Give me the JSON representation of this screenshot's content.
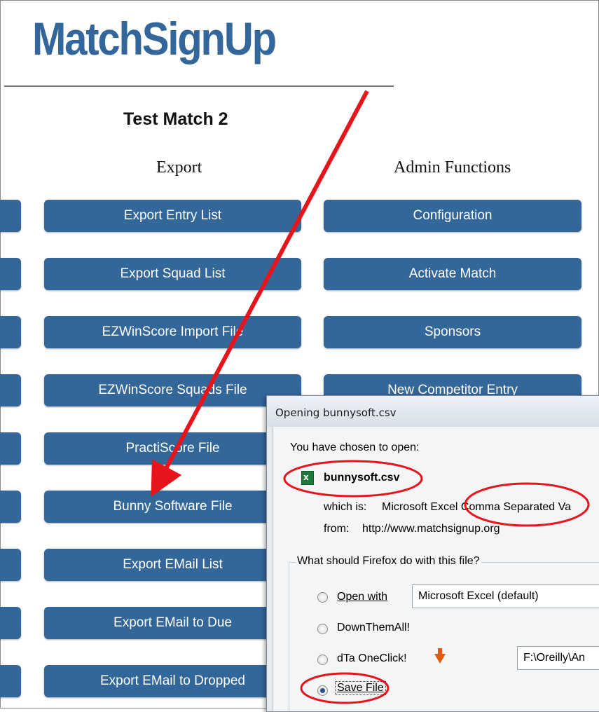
{
  "logo": "MatchSignUp",
  "match_title": "Test Match 2",
  "columns": {
    "export": "Export",
    "admin": "Admin Functions"
  },
  "export_buttons": [
    "Export Entry List",
    "Export Squad List",
    "EZWinScore Import File",
    "EZWinScore Squads File",
    "PractiScore File",
    "Bunny Software File",
    "Export EMail List",
    "Export EMail to Due",
    "Export EMail to Dropped"
  ],
  "admin_buttons": [
    "Configuration",
    "Activate Match",
    "Sponsors",
    "New Competitor Entry"
  ],
  "dialog": {
    "title": "Opening bunnysoft.csv",
    "chosen_label": "You have chosen to open:",
    "file_name": "bunnysoft.csv",
    "which_is_label": "which is:",
    "which_is_value": "Microsoft Excel Comma Separated Va",
    "from_label": "from:",
    "from_value": "http://www.matchsignup.org",
    "question": "What should Firefox do with this file?",
    "open_with_label": "Open with",
    "open_with_value": "Microsoft Excel (default)",
    "downthemall_label": "DownThemAll!",
    "dta_label": "dTa OneClick!",
    "dta_path": "F:\\Oreilly\\An",
    "save_file_label": "Save File",
    "selected_option": "Save File",
    "file_icon": "excel-csv-icon",
    "dta_icon": "orange-arrow-icon"
  },
  "colors": {
    "brand": "#33669a",
    "button": "#336699",
    "annotation": "#e8141b"
  }
}
